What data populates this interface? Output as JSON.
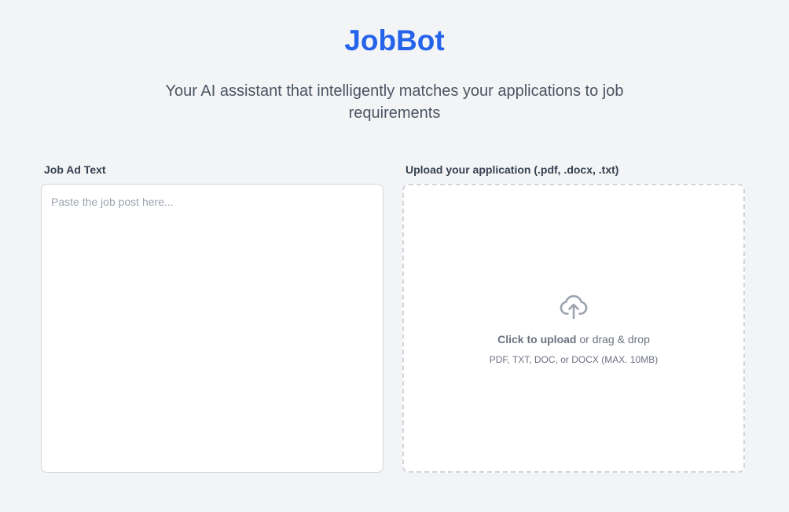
{
  "header": {
    "title": "JobBot",
    "subtitle": "Your AI assistant that intelligently matches your applications to job requirements"
  },
  "job_ad": {
    "label": "Job Ad Text",
    "placeholder": "Paste the job post here...",
    "value": ""
  },
  "upload": {
    "label": "Upload your application (.pdf, .docx, .txt)",
    "icon": "cloud-upload-icon",
    "click_text": "Click to upload",
    "drag_text": " or drag & drop",
    "hint": "PDF, TXT, DOC, or DOCX (MAX. 10MB)"
  },
  "colors": {
    "accent": "#2563eb",
    "background": "#f3f4f6"
  }
}
